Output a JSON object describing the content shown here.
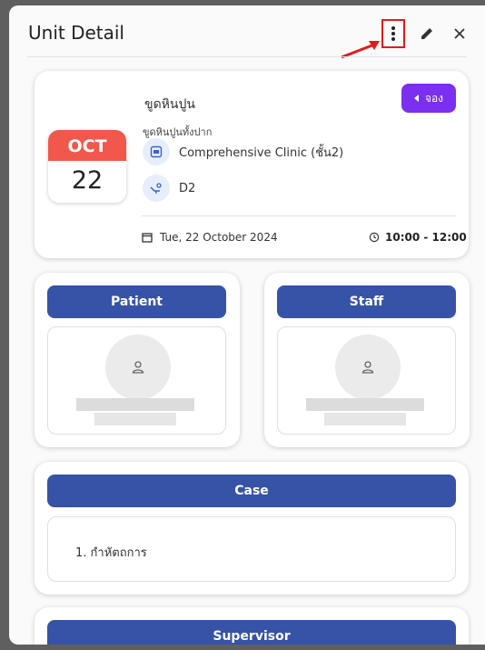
{
  "header": {
    "title": "Unit Detail"
  },
  "appointment": {
    "service": "ขูดหินปูน",
    "booking_label": "จอง",
    "sub_service": "ขูดหินปูนทั้งปาก",
    "clinic": "Comprehensive Clinic (ชั้น2)",
    "unit": "D2",
    "month": "OCT",
    "day": "22",
    "date_full": "Tue, 22 October 2024",
    "time_range": "10:00 - 12:00"
  },
  "patient": {
    "label": "Patient"
  },
  "staff": {
    "label": "Staff"
  },
  "case": {
    "label": "Case",
    "items": [
      "1. กำหัตถการ"
    ]
  },
  "supervisor": {
    "label": "Supervisor"
  },
  "colors": {
    "primary": "#3653a7",
    "booking": "#7b2ff0",
    "month_badge": "#f2574b",
    "highlight": "#e21b1b"
  }
}
